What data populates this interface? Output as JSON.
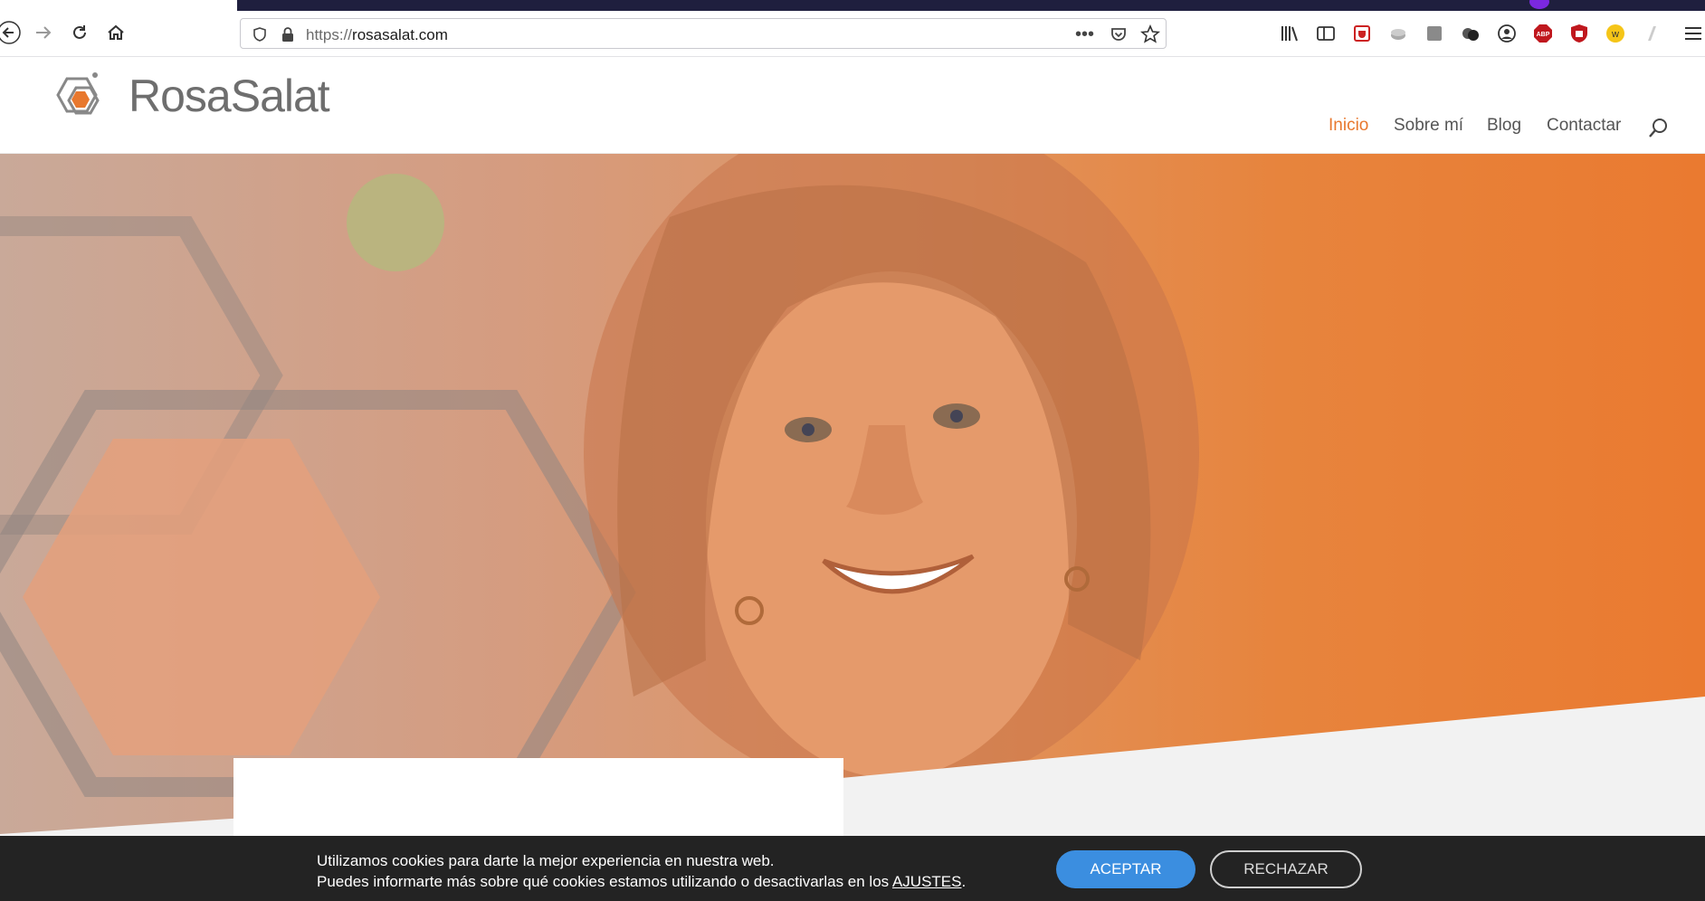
{
  "browser": {
    "url_scheme": "https://",
    "url_host": "rosasalat.com",
    "icons": [
      "back-icon",
      "forward-icon",
      "reload-icon",
      "home-icon",
      "shield-icon",
      "lock-icon",
      "more-icon",
      "pocket-icon",
      "bookmark-star-icon",
      "library-icon",
      "sidebar-icon",
      "ext-icon",
      "ext-icon",
      "ext-icon",
      "ext-icon",
      "account-icon",
      "adblock-icon",
      "ublock-icon",
      "ext-icon",
      "ext-icon",
      "menu-icon"
    ],
    "adblock_label": "ABP"
  },
  "site": {
    "logo": "RosaSalat",
    "nav": [
      "Inicio",
      "Sobre mí",
      "Blog",
      "Contactar"
    ],
    "accent": "#e8782e"
  },
  "cookies": {
    "line1": "Utilizamos cookies para darte la mejor experiencia en nuestra web.",
    "line2": "Puedes informarte más sobre qué cookies estamos utilizando o desactivarlas en los ",
    "link": "AJUSTES",
    "end": ".",
    "accept": "ACEPTAR",
    "reject": "RECHAZAR"
  }
}
